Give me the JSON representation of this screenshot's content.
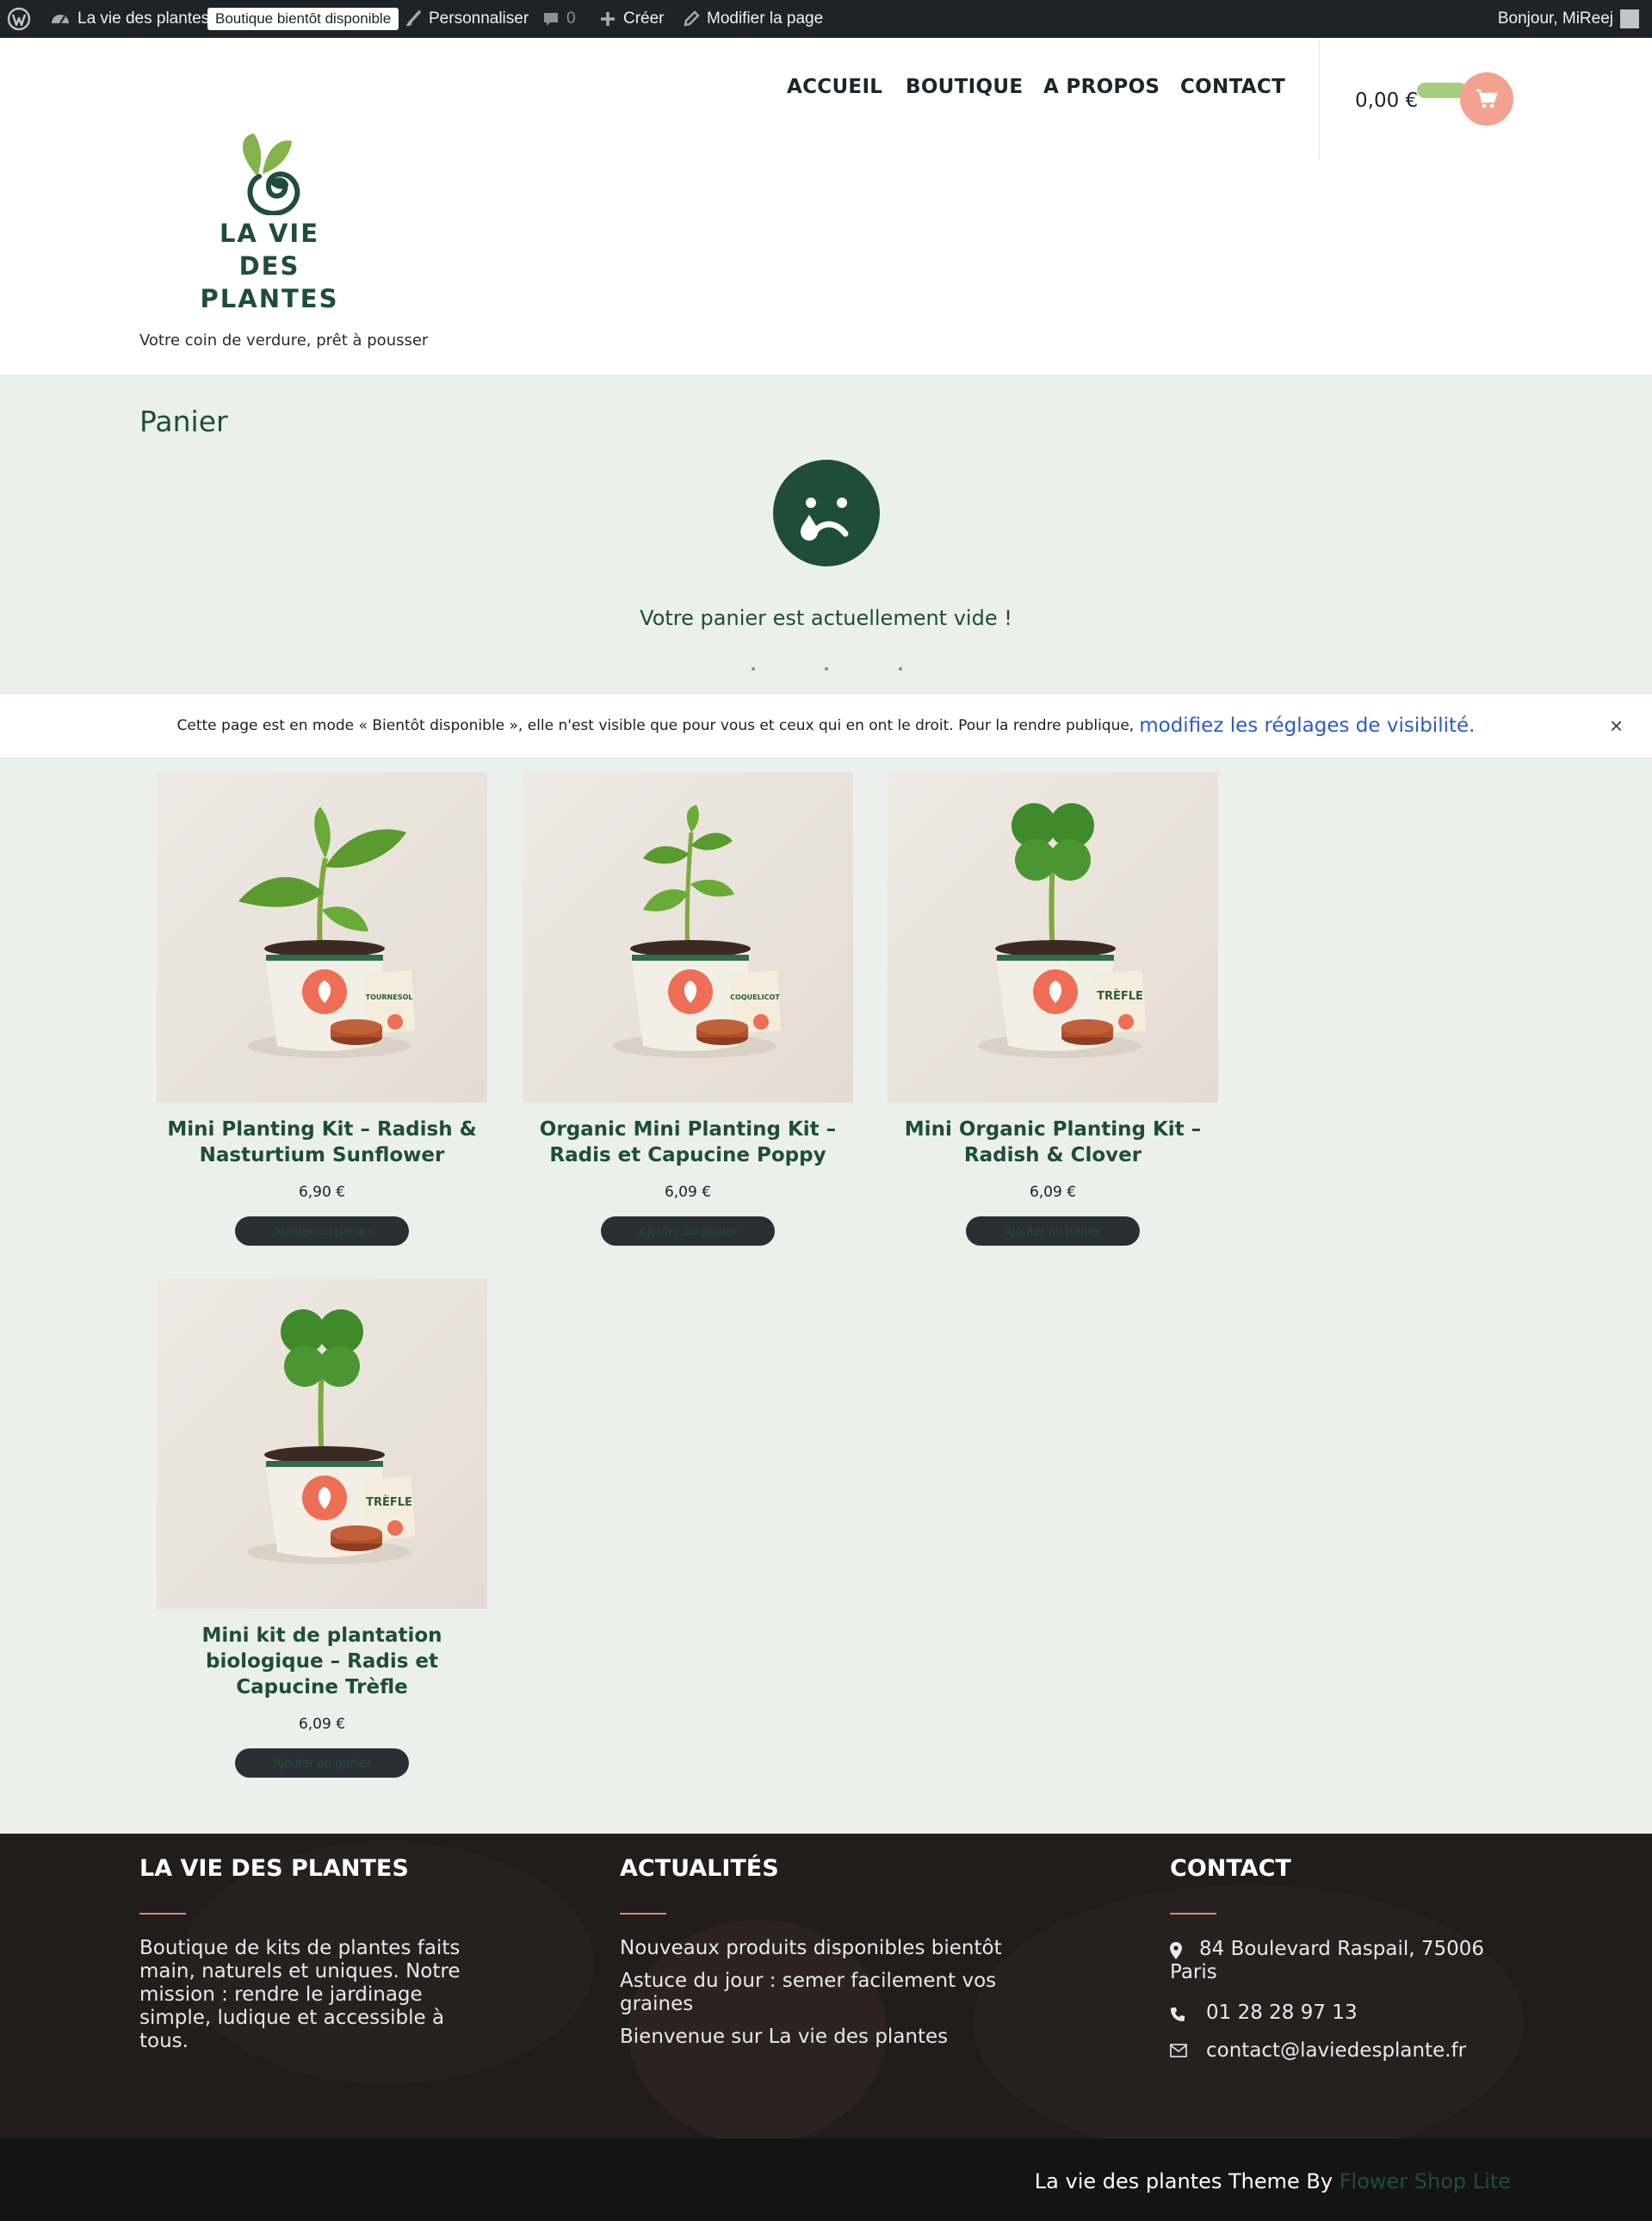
{
  "adminbar": {
    "site_name": "La vie des plantes",
    "badge": "Boutique bientôt disponible",
    "customize": "Personnaliser",
    "comments_count": "0",
    "create": "Créer",
    "edit_page": "Modifier la page",
    "greeting": "Bonjour, MiReej"
  },
  "header": {
    "nav": [
      "ACCUEIL",
      "BOUTIQUE",
      "A PROPOS",
      "CONTACT"
    ],
    "cart_total": "0,00 €",
    "logo_line1": "LA VIE DES",
    "logo_line2": "PLANTES",
    "tagline": "Votre coin de verdure, prêt à pousser"
  },
  "main": {
    "page_title": "Panier",
    "empty_message": "Votre panier est actuellement vide !"
  },
  "notice": {
    "text": "Cette page est en mode « Bientôt disponible », elle n'est visible que pour vous et ceux qui en ont le droit. Pour la rendre publique,",
    "link": "modifiez les réglages de visibilité",
    "suffix": ".",
    "close": "×"
  },
  "products": [
    {
      "title": "Mini Planting Kit – Radish & Nasturtium Sunflower",
      "price": "6,90 €",
      "button": "Ajouter au panier",
      "tag": "TOURNESOL",
      "plant": "sunflower"
    },
    {
      "title": "Organic Mini Planting Kit – Radis et Capucine Poppy",
      "price": "6,09 €",
      "button": "Ajouter au panier",
      "tag": "COQUELICOT",
      "plant": "poppy"
    },
    {
      "title": "Mini Organic Planting Kit – Radish & Clover",
      "price": "6,09 €",
      "button": "Ajouter au panier",
      "tag": "TRÈFLE",
      "plant": "clover"
    },
    {
      "title": "Mini kit de plantation biologique – Radis et Capucine Trèfle",
      "price": "6,09 €",
      "button": "Ajouter au panier",
      "tag": "TRÈFLE",
      "plant": "clover"
    }
  ],
  "footer": {
    "col1": {
      "title": "LA VIE DES PLANTES",
      "text": "Boutique de kits de plantes faits main, naturels et uniques. Notre mission : rendre le jardinage simple, ludique et accessible à tous."
    },
    "col2": {
      "title": "ACTUALITÉS",
      "items": [
        "Nouveaux produits disponibles bientôt",
        "Astuce du jour : semer facilement vos graines",
        "Bienvenue sur La vie des plantes"
      ]
    },
    "col3": {
      "title": "CONTACT",
      "address": "84 Boulevard Raspail, 75006 Paris",
      "phone": "01 28 28 97 13",
      "email": "contact@laviedesplante.fr"
    },
    "credit_text": "La vie des plantes Theme By ",
    "credit_link": "Flower Shop Lite"
  },
  "colors": {
    "brand_green": "#1f4d3a",
    "accent_coral": "#f2a28f",
    "adminbar": "#1d2327",
    "main_bg": "#ebf0ed",
    "footer_bg": "#231c1c"
  }
}
